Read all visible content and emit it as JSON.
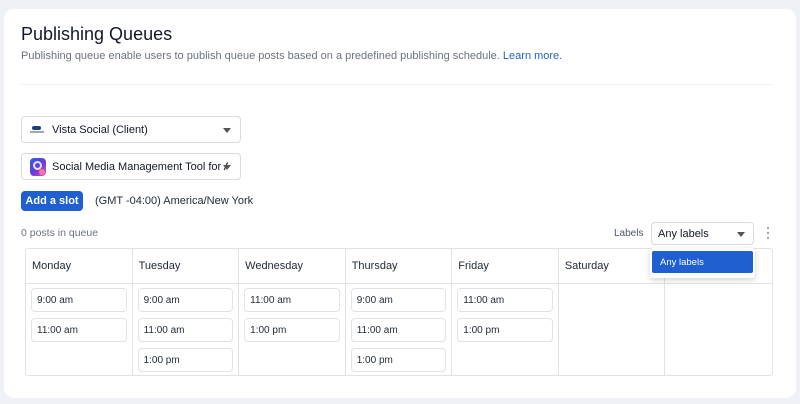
{
  "header": {
    "title": "Publishing Queues",
    "subtitle": "Publishing queue enable users to publish queue posts based on a predefined publishing schedule.",
    "learn_more": "Learn more."
  },
  "selectors": {
    "client": {
      "value": "Vista Social (Client)",
      "icon": "vista-social-logo-icon"
    },
    "profile": {
      "value": "Social Media Management Tool for Agencies",
      "icon": "profile-avatar-icon"
    }
  },
  "actions": {
    "add_slot_label": "Add a slot",
    "timezone": "(GMT -04:00) America/New York"
  },
  "queue": {
    "count_text": "0 posts in queue",
    "labels_label": "Labels",
    "labels_value": "Any labels",
    "labels_options": [
      "Any labels"
    ]
  },
  "colors": {
    "primary": "#1f5fd1",
    "link": "#2563c9",
    "background": "#eef1f6"
  },
  "schedule": [
    {
      "day": "Monday",
      "slots": [
        "9:00 am",
        "11:00 am"
      ]
    },
    {
      "day": "Tuesday",
      "slots": [
        "9:00 am",
        "11:00 am",
        "1:00 pm"
      ]
    },
    {
      "day": "Wednesday",
      "slots": [
        "11:00 am",
        "1:00 pm"
      ]
    },
    {
      "day": "Thursday",
      "slots": [
        "9:00 am",
        "11:00 am",
        "1:00 pm"
      ]
    },
    {
      "day": "Friday",
      "slots": [
        "11:00 am",
        "1:00 pm"
      ]
    },
    {
      "day": "Saturday",
      "slots": []
    },
    {
      "day": "",
      "slots": []
    }
  ]
}
